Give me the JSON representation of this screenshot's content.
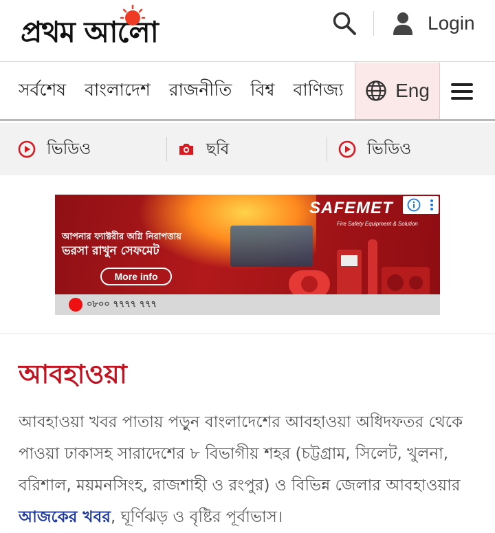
{
  "header": {
    "logo_text": "প্রথম আলো",
    "login_label": "Login"
  },
  "nav": {
    "items": [
      {
        "label": "সর্বশেষ"
      },
      {
        "label": "বাংলাদেশ"
      },
      {
        "label": "রাজনীতি"
      },
      {
        "label": "বিশ্ব"
      },
      {
        "label": "বাণিজ্য"
      }
    ],
    "language_label": "Eng"
  },
  "media_strip": {
    "items": [
      {
        "label": "ভিডিও",
        "icon": "play-circle-icon"
      },
      {
        "label": "ছবি",
        "icon": "camera-icon"
      },
      {
        "label": "ভিডিও",
        "icon": "play-circle-icon"
      }
    ]
  },
  "ad": {
    "headline_line1": "আপনার ফ্যাক্টরীর অগ্নি নিরাপত্তায়",
    "headline_line2": "ভরসা রাখুন সেফমেট",
    "more_info_label": "More info",
    "brand": "SAFEMET",
    "brand_tagline": "Fire Safety Equipment & Solution",
    "phone": "০৮০০ ৭৭৭৭ ৭৭৭"
  },
  "article": {
    "title": "আবহাওয়া",
    "description_before": "আবহাওয়া খবর পাতায় পড়ুন বাংলাদেশের আবহাওয়া অধিদফতর থেকে পাওয়া ঢাকাসহ সারাদেশের ৮ বিভাগীয় শহর (চট্টগ্রাম, সিলেট, খুলনা, বরিশাল, ময়মনসিংহ, রাজশাহী ও রংপুর) ও বিভিন্ন জেলার আবহাওয়ার ",
    "description_link": "আজকের খবর",
    "description_after": ", ঘূর্ণিঝড় ও বৃষ্টির পূর্বাভাস।"
  },
  "colors": {
    "brand_red": "#c1121f",
    "link_blue": "#1f3a9c",
    "lang_bg": "#fbe9e9",
    "sun_orange": "#ef3b24"
  }
}
